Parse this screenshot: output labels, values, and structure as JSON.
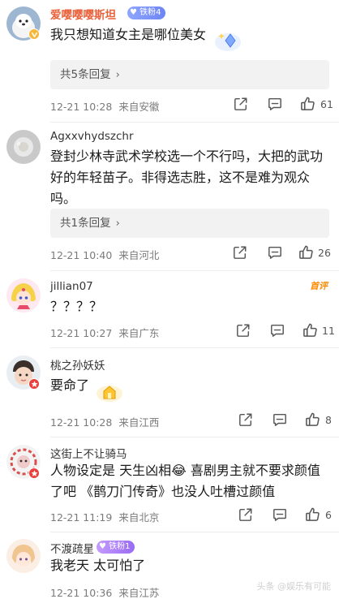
{
  "comments": [
    {
      "user": "爱嘤嘤嘤斯坦",
      "badge": "铁粉4",
      "text": "我只想知道女主是哪位美女",
      "reply_label": "共5条回复",
      "time": "12-21 10:28",
      "location": "来自安徽",
      "likes": "61"
    },
    {
      "user": "Agxxvhydszchr",
      "text": "登封少林寺武术学校选一个不行吗，大把的武功好的年轻苗子。非得选志胜，这不是难为观众吗。",
      "reply_label": "共1条回复",
      "time": "12-21 10:40",
      "location": "来自河北",
      "likes": "26"
    },
    {
      "user": "jillian07",
      "tag": "首评",
      "text": "？？？？",
      "time": "12-21 10:27",
      "location": "来自广东",
      "likes": "11"
    },
    {
      "user": "桃之孙妖妖",
      "text": "要命了",
      "time": "12-21 10:28",
      "location": "来自江西",
      "likes": "8"
    },
    {
      "user": "这街上不让骑马",
      "text": "人物设定是 天生凶相😂 喜剧男主就不要求颜值了吧 《鹊刀门传奇》也没人吐槽过颜值",
      "time": "12-21 11:19",
      "location": "来自北京",
      "likes": "6"
    },
    {
      "user": "不渡疏星",
      "badge": "铁粉1",
      "text": "我老天 太可怕了",
      "time": "12-21 10:36",
      "location": "来自江苏",
      "likes": ""
    }
  ],
  "watermark": "头条 @娱乐有可能",
  "reply_arrow": "›",
  "colors": {
    "accent": "#e8613b",
    "meta": "#7a7a7a",
    "reply_bg": "#f2f2f2",
    "top_tag": "#ff8a00"
  }
}
